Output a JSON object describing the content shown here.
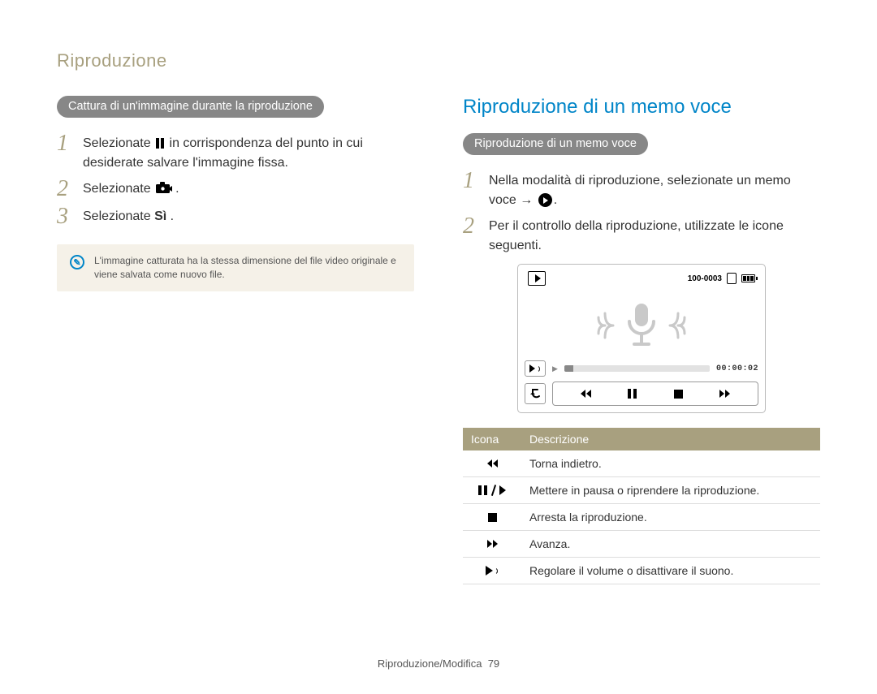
{
  "page_header": "Riproduzione",
  "left": {
    "pill": "Cattura di un'immagine durante la riproduzione",
    "steps": [
      {
        "n": "1",
        "pre": "Selezionate ",
        "icon": "pause",
        "post": " in corrispondenza del punto in cui desiderate salvare l'immagine fissa."
      },
      {
        "n": "2",
        "pre": "Selezionate ",
        "icon": "capture-cam",
        "post": "."
      },
      {
        "n": "3",
        "pre": "Selezionate ",
        "bold": "Sì",
        "post": " ."
      }
    ],
    "note": "L'immagine catturata ha la stessa dimensione del file video originale e viene salvata come nuovo file."
  },
  "right": {
    "heading": "Riproduzione di un memo voce",
    "pill": "Riproduzione di un memo voce",
    "steps": [
      {
        "n": "1",
        "pre": "Nella modalità di riproduzione, selezionate un memo voce → ",
        "icon": "play-circle",
        "post": "."
      },
      {
        "n": "2",
        "pre": "Per il controllo della riproduzione, utilizzate le icone seguenti.",
        "post": ""
      }
    ],
    "player": {
      "file_index": "100-0003",
      "time_code": "00:00:02"
    },
    "table": {
      "headers": {
        "icon": "Icona",
        "desc": "Descrizione"
      },
      "rows": [
        {
          "icon": "rewind",
          "desc": "Torna indietro."
        },
        {
          "icon": "pause-play",
          "desc": "Mettere in pausa o riprendere la riproduzione."
        },
        {
          "icon": "stop",
          "desc": "Arresta la riproduzione."
        },
        {
          "icon": "forward",
          "desc": "Avanza."
        },
        {
          "icon": "volume",
          "desc": "Regolare il volume o disattivare il suono."
        }
      ]
    }
  },
  "footer": {
    "section": "Riproduzione/Modifica",
    "page": "79"
  }
}
